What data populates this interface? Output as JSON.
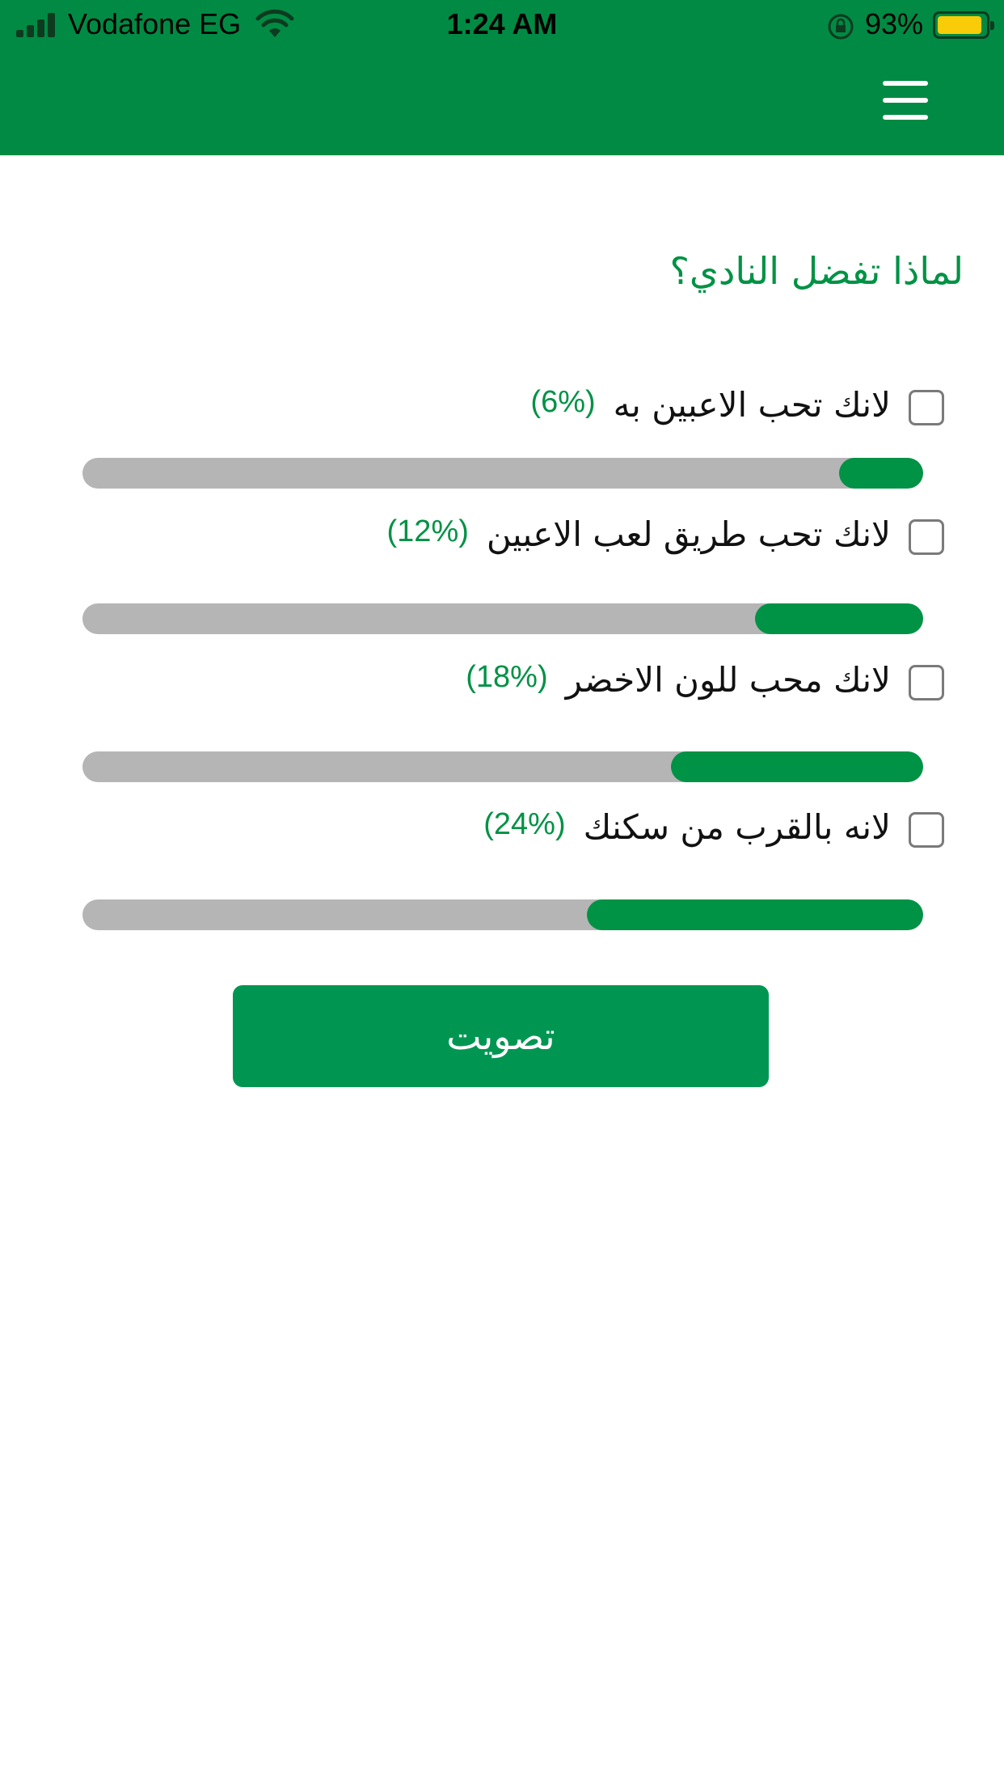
{
  "status_bar": {
    "carrier": "Vodafone EG",
    "time": "1:24 AM",
    "battery": "93%",
    "battery_color": "#f8cc09"
  },
  "header": {
    "background": "#018a43",
    "menu_icon": "hamburger-menu-icon"
  },
  "poll": {
    "question": "لماذا تفضل النادي؟",
    "options": [
      {
        "label": "لانك تحب  الاعبين به",
        "percent_text": "(6%)",
        "percent": 6
      },
      {
        "label": "لانك تحب طريق لعب الاعبين",
        "percent_text": "(12%)",
        "percent": 12
      },
      {
        "label": "لانك محب للون الاخضر",
        "percent_text": "(18%)",
        "percent": 18
      },
      {
        "label": "لانه بالقرب من سكنك",
        "percent_text": "(24%)",
        "percent": 24
      }
    ],
    "accent": "#009245",
    "track_color": "#b5b5b5"
  },
  "vote_button": {
    "label": "تصويت"
  }
}
